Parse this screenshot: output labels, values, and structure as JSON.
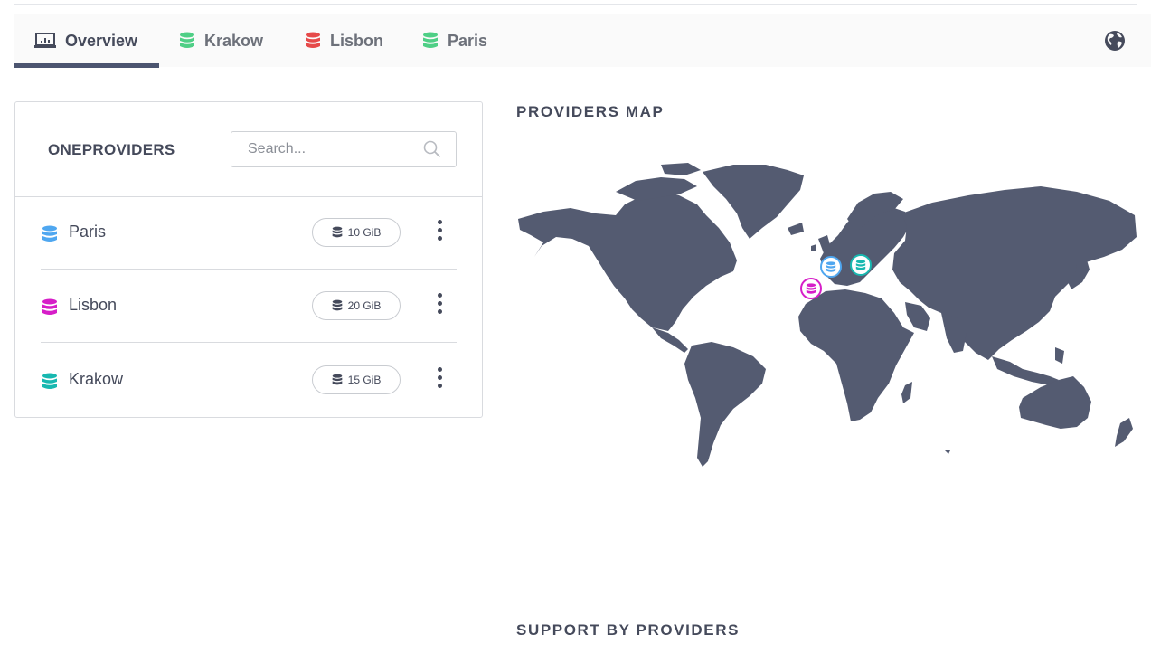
{
  "tabs": [
    {
      "label": "Overview",
      "icon": "overview-icon",
      "active": true
    },
    {
      "label": "Krakow",
      "icon": "database-icon",
      "color": "#4fcf86"
    },
    {
      "label": "Lisbon",
      "icon": "database-icon",
      "color": "#e64a4a"
    },
    {
      "label": "Paris",
      "icon": "database-icon",
      "color": "#4fcf86"
    }
  ],
  "providers_panel": {
    "title": "ONEPROVIDERS",
    "search_placeholder": "Search...",
    "items": [
      {
        "name": "Paris",
        "support": "10 GiB",
        "color": "#4fa7f0"
      },
      {
        "name": "Lisbon",
        "support": "20 GiB",
        "color": "#d61ec8"
      },
      {
        "name": "Krakow",
        "support": "15 GiB",
        "color": "#18b8b0"
      }
    ]
  },
  "map": {
    "title": "PROVIDERS MAP"
  },
  "support_section": {
    "title": "SUPPORT BY PROVIDERS"
  }
}
